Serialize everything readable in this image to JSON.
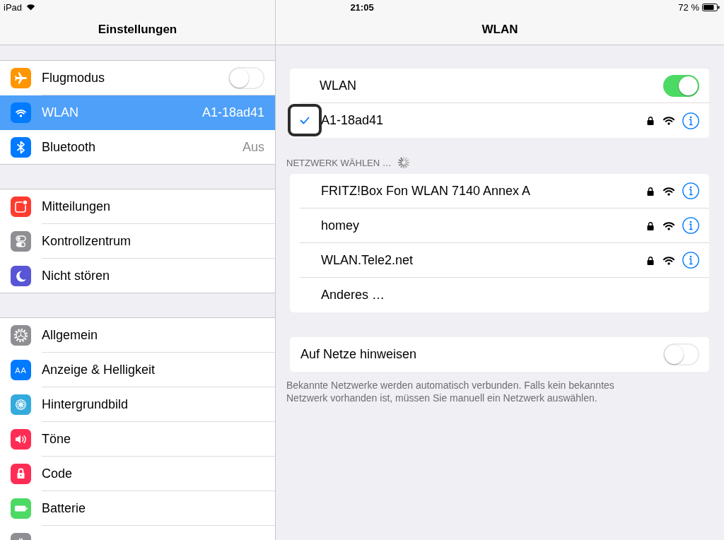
{
  "status_bar": {
    "device": "iPad",
    "time": "21:05",
    "battery": "72 %"
  },
  "sidebar": {
    "title": "Einstellungen",
    "groups": [
      {
        "items": [
          {
            "label": "Flugmodus",
            "kind": "toggle",
            "on": false,
            "color": "#ff9500",
            "selected": false
          },
          {
            "label": "WLAN",
            "kind": "value",
            "value": "A1-18ad41",
            "color": "#007aff",
            "selected": true
          },
          {
            "label": "Bluetooth",
            "kind": "value",
            "value": "Aus",
            "color": "#007aff",
            "selected": false
          }
        ]
      },
      {
        "items": [
          {
            "label": "Mitteilungen",
            "kind": "link",
            "color": "#ff3b30",
            "selected": false
          },
          {
            "label": "Kontrollzentrum",
            "kind": "link",
            "color": "#8e8e93",
            "selected": false
          },
          {
            "label": "Nicht stören",
            "kind": "link",
            "color": "#5856d6",
            "selected": false
          }
        ]
      },
      {
        "items": [
          {
            "label": "Allgemein",
            "kind": "link",
            "color": "#8e8e93",
            "selected": false
          },
          {
            "label": "Anzeige & Helligkeit",
            "kind": "link",
            "icon_text": "AA",
            "color": "#007aff",
            "selected": false
          },
          {
            "label": "Hintergrundbild",
            "kind": "link",
            "color": "#35aadc",
            "selected": false
          },
          {
            "label": "Töne",
            "kind": "link",
            "color": "#ff2d55",
            "selected": false
          },
          {
            "label": "Code",
            "kind": "link",
            "color": "#ff2d55",
            "selected": false
          },
          {
            "label": "Batterie",
            "kind": "link",
            "color": "#4cd964",
            "selected": false
          },
          {
            "kind": "link",
            "color": "#8e8e93",
            "selected": false
          }
        ]
      }
    ]
  },
  "detail": {
    "title": "WLAN",
    "wlan": {
      "label": "WLAN",
      "on": true
    },
    "current_network": {
      "name": "A1-18ad41",
      "connected": true,
      "focused": true,
      "secured": true
    },
    "section": {
      "header": "NETZWERK WÄHLEN …",
      "searching": true
    },
    "networks": [
      {
        "name": "FRITZ!Box Fon WLAN 7140 Annex A",
        "secured": true
      },
      {
        "name": "homey",
        "secured": true
      },
      {
        "name": "WLAN.Tele2.net",
        "secured": true
      }
    ],
    "other_network": "Anderes …",
    "notify": {
      "label": "Auf Netze hinweisen",
      "on": false
    },
    "footer": "Bekannte Netzwerke werden automatisch verbunden. Falls kein bekanntes Netzwerk vorhanden ist, müssen Sie manuell ein Netzwerk auswählen."
  }
}
